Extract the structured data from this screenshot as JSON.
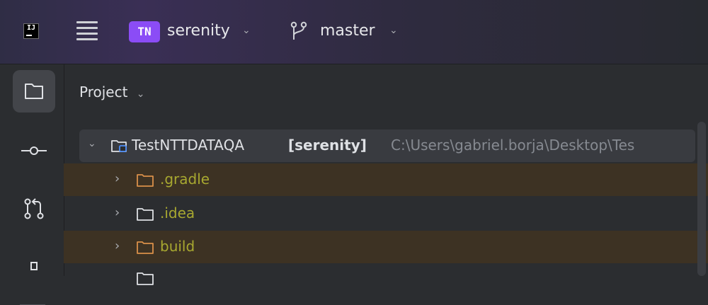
{
  "app": {
    "logo_text": "IJ"
  },
  "header": {
    "project_badge": "TN",
    "project_name": "serenity",
    "branch_name": "master"
  },
  "toolwindow": {
    "title": "Project"
  },
  "tree": {
    "root": {
      "name": "TestNTTDATAQA",
      "module": "[serenity]",
      "path": "C:\\Users\\gabriel.borja\\Desktop\\Tes"
    },
    "items": [
      {
        "name": ".gradle"
      },
      {
        "name": ".idea"
      },
      {
        "name": "build"
      }
    ]
  },
  "colors": {
    "accent_badge": "#8b4cf6",
    "ignored_text": "#a8a830",
    "modified_row": "#3d3223",
    "folder_orange": "#d9904a"
  }
}
